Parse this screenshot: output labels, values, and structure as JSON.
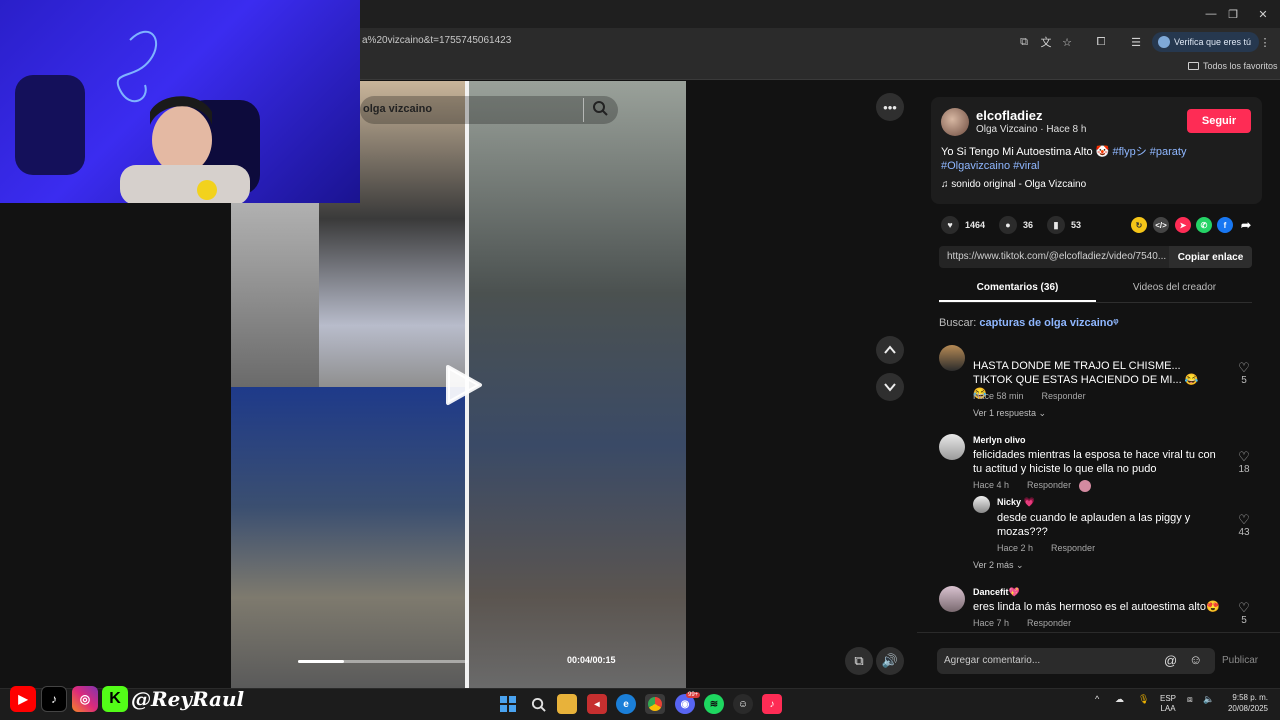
{
  "browser": {
    "url_fragment": "a%20vizcaino&t=1755745061423",
    "verify_label": "Verifica que eres tú",
    "favorites_label": "Todos los favoritos"
  },
  "video": {
    "search_text": "olga vizcaino",
    "time": "00:04/00:15",
    "progress": 0.27
  },
  "post": {
    "username": "elcofladiez",
    "subtitle": "Olga Vizcaino · Hace 8 h",
    "follow_label": "Seguir",
    "caption": "Yo Si Tengo Mi Autoestima Alto 🤡 ",
    "hashtags_line1": "#flypシ #paraty",
    "hashtags_line2": "#Olgavizcaino #viral",
    "music": "♫  sonido original - Olga Vizcaino",
    "likes": "1464",
    "comments": "36",
    "saves": "53",
    "link": "https://www.tiktok.com/@elcofladiez/video/7540...",
    "copy_label": "Copiar enlace"
  },
  "tabs": {
    "comments": "Comentarios (36)",
    "creator": "Videos del creador"
  },
  "related_search": {
    "label": "Buscar: ",
    "query": "capturas de olga vizcaino"
  },
  "comments": [
    {
      "name": "",
      "text": "HASTA DONDE ME TRAJO EL CHISME... TIKTOK QUE ESTAS HACIENDO DE MI... 😂 😂",
      "time": "Hace 58 min",
      "reply": "Responder",
      "likes": "5",
      "more": "Ver 1 respuesta ⌄"
    },
    {
      "name": "Merlyn olivo",
      "text": "felicidades mientras la esposa te hace viral tu con tu actitud y hiciste lo que ella no pudo",
      "time": "Hace 4 h",
      "reply": "Responder",
      "likes": "18"
    },
    {
      "name": "Nicky 💗",
      "text": "desde cuando le aplauden a las piggy y mozas???",
      "time": "Hace 2 h",
      "reply": "Responder",
      "likes": "43",
      "more": "Ver 2 más ⌄"
    },
    {
      "name": "Dancefit💖",
      "text": "eres linda lo más hermoso es el autoestima alto😍",
      "time": "Hace 7 h",
      "reply": "Responder",
      "likes": "5"
    }
  ],
  "comment_input": {
    "placeholder": "Agregar comentario...",
    "publish": "Publicar"
  },
  "taskbar": {
    "lang": "ESP",
    "lang2": "LAA",
    "time": "9:58 p. m.",
    "date": "20/08/2025",
    "badge": "99+"
  },
  "overlay": {
    "handle": "@ReyRaul"
  },
  "colors": {
    "accent": "#fe2c55",
    "link": "#8fb7ff",
    "panel_bg": "#121212"
  }
}
